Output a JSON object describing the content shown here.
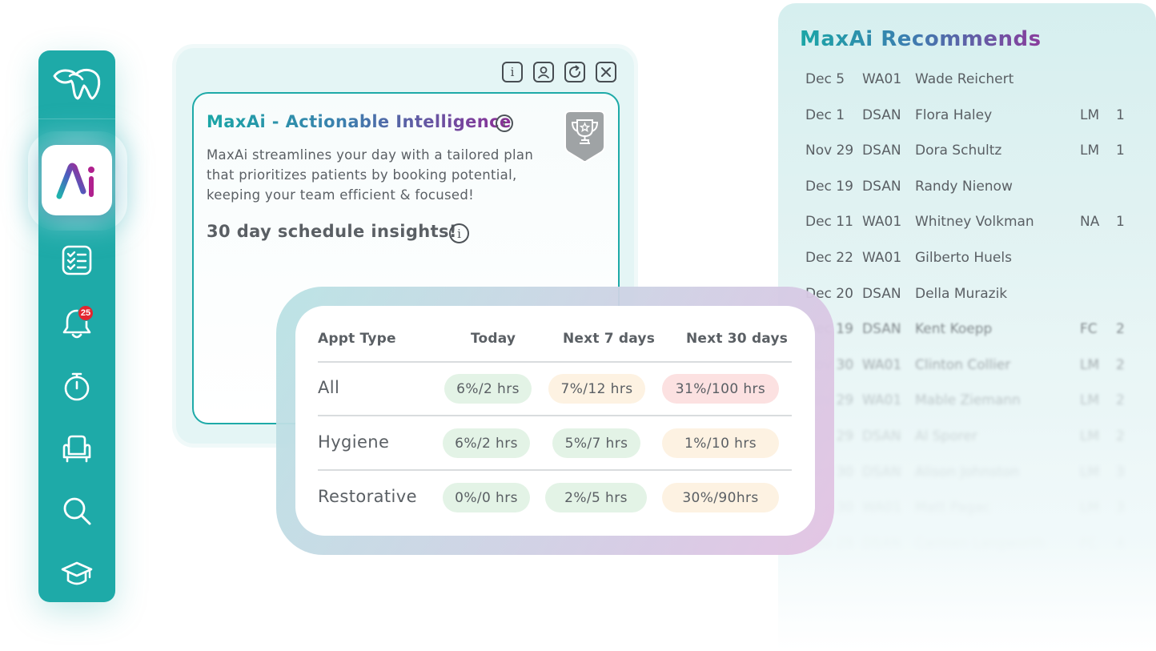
{
  "sidebar": {
    "badge_count": "25",
    "icons": [
      "tooth-logo-icon",
      "maxai-app-icon",
      "checklist-icon",
      "bell-icon",
      "stopwatch-icon",
      "chair-icon",
      "search-icon",
      "graduation-cap-icon"
    ]
  },
  "card": {
    "title": "MaxAi - Actionable Intelligence",
    "description": "MaxAi streamlines your day with a tailored plan that prioritizes patients by booking potential, keeping your team efficient & focused!",
    "subtitle": "30 day schedule insights!",
    "info_glyph": "i"
  },
  "insights_table": {
    "headers": [
      "Appt Type",
      "Today",
      "Next 7 days",
      "Next 30 days"
    ],
    "rows": [
      {
        "label": "All",
        "today": "6%/2 hrs",
        "next7": "7%/12 hrs",
        "next30": "31%/100 hrs"
      },
      {
        "label": "Hygiene",
        "today": "6%/2 hrs",
        "next7": "5%/7 hrs",
        "next30": "1%/10 hrs"
      },
      {
        "label": "Restorative",
        "today": "0%/0 hrs",
        "next7": "2%/5 hrs",
        "next30": "30%/90hrs"
      }
    ],
    "colors": {
      "green": "#e3f3e6",
      "amber": "#fdf2e2",
      "red": "#fce1e1"
    }
  },
  "recommends": {
    "title": "MaxAi Recommends",
    "rows": [
      {
        "date": "Dec 5",
        "code": "WA01",
        "name": "Wade Reichert",
        "tag": "",
        "num": ""
      },
      {
        "date": "Dec 1",
        "code": "DSAN",
        "name": "Flora Haley",
        "tag": "LM",
        "num": "1"
      },
      {
        "date": "Nov 29",
        "code": "DSAN",
        "name": "Dora Schultz",
        "tag": "LM",
        "num": "1"
      },
      {
        "date": "Dec 19",
        "code": "DSAN",
        "name": "Randy Nienow",
        "tag": "",
        "num": ""
      },
      {
        "date": "Dec 11",
        "code": "WA01",
        "name": "Whitney Volkman",
        "tag": "NA",
        "num": "1"
      },
      {
        "date": "Dec 22",
        "code": "WA01",
        "name": "Gilberto Huels",
        "tag": "",
        "num": ""
      },
      {
        "date": "Dec 20",
        "code": "DSAN",
        "name": "Della Murazik",
        "tag": "",
        "num": ""
      },
      {
        "date": "Dec 19",
        "code": "DSAN",
        "name": "Kent Koepp",
        "tag": "FC",
        "num": "2"
      },
      {
        "date": "Nov 30",
        "code": "WA01",
        "name": "Clinton Collier",
        "tag": "LM",
        "num": "2"
      },
      {
        "date": "Nov 29",
        "code": "WA01",
        "name": "Mable Ziemann",
        "tag": "LM",
        "num": "2"
      },
      {
        "date": "Nov 29",
        "code": "DSAN",
        "name": "Al Sporer",
        "tag": "LM",
        "num": "2"
      },
      {
        "date": "Nov 30",
        "code": "DSAN",
        "name": "Alison Johnston",
        "tag": "LM",
        "num": "3"
      },
      {
        "date": "Nov 30",
        "code": "WA01",
        "name": "Matt Pagac",
        "tag": "LM",
        "num": "3"
      },
      {
        "date": "Nov 29",
        "code": "DSAN",
        "name": "Carmen Langworth",
        "tag": "FC",
        "num": "4"
      }
    ]
  },
  "theme": {
    "teal": "#1eaaa8",
    "purple": "#8e2e97",
    "text": "#5a5f64"
  }
}
